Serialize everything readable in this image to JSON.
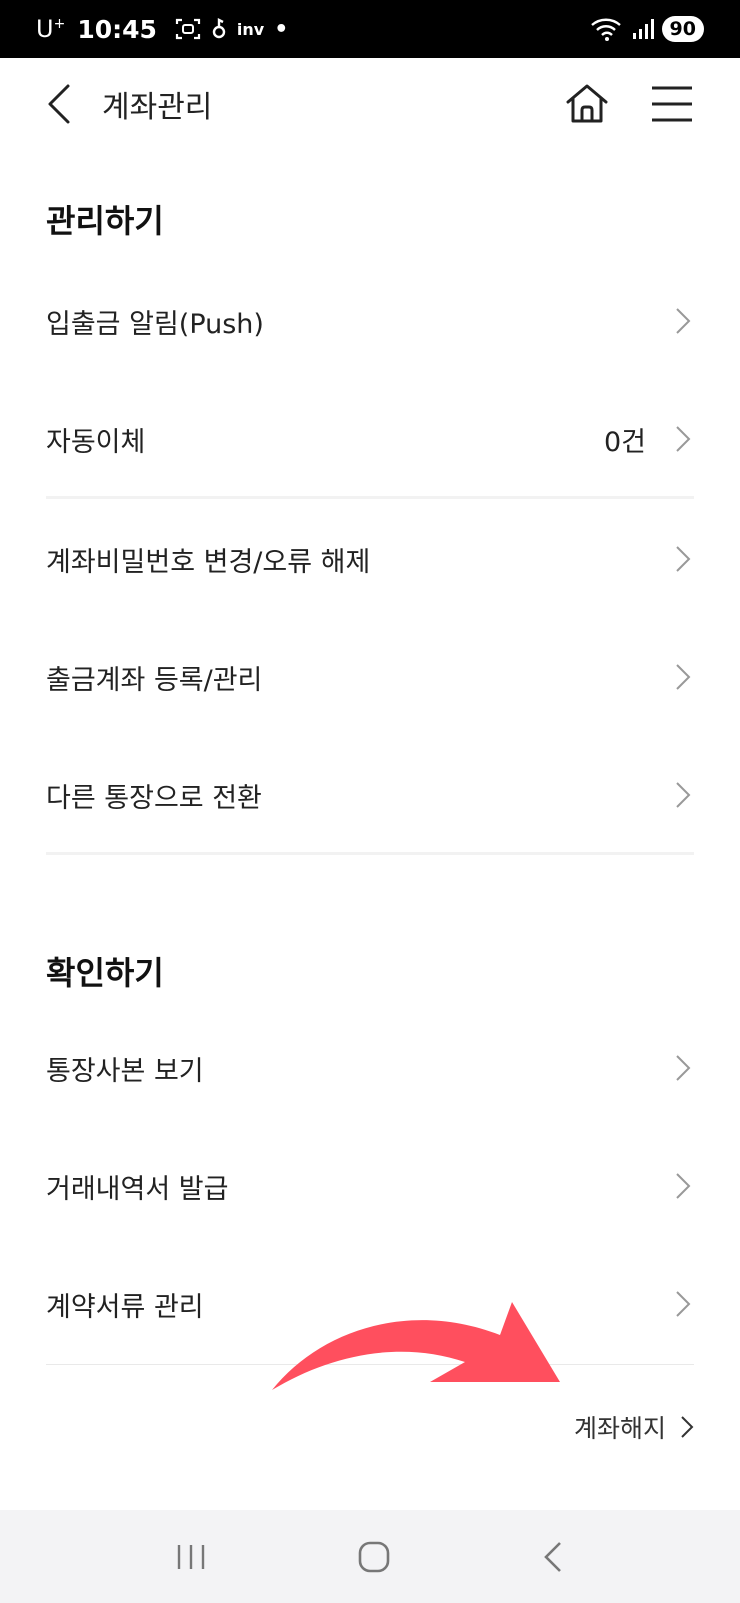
{
  "status_bar": {
    "carrier": "U",
    "carrier_sup": "+",
    "time": "10:45",
    "inv_label": "inv",
    "battery": "90"
  },
  "header": {
    "title": "계좌관리"
  },
  "sections": {
    "manage": {
      "title": "관리하기",
      "items": [
        {
          "label": "입출금 알림(Push)"
        },
        {
          "label": "자동이체",
          "value": "0건"
        },
        {
          "label": "계좌비밀번호 변경/오류 해제"
        },
        {
          "label": "출금계좌 등록/관리"
        },
        {
          "label": "다른 통장으로 전환"
        }
      ]
    },
    "check": {
      "title": "확인하기",
      "items": [
        {
          "label": "통장사본 보기"
        },
        {
          "label": "거래내역서 발급"
        },
        {
          "label": "계약서류 관리"
        }
      ]
    }
  },
  "footer_link": {
    "label": "계좌해지"
  },
  "colors": {
    "annotation_arrow": "#ff4f5e",
    "nav_bar_bg": "#f3f3f5"
  }
}
